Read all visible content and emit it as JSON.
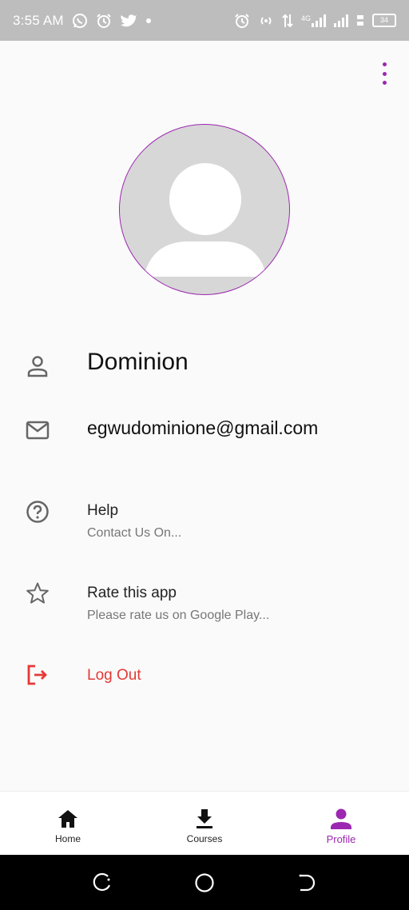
{
  "status_bar": {
    "time": "3:55 AM",
    "network": "4G",
    "battery": "34"
  },
  "profile": {
    "name": "Dominion",
    "email": "egwudominione@gmail.com"
  },
  "menu": {
    "help_title": "Help",
    "help_subtitle": "Contact Us On...",
    "rate_title": "Rate this app",
    "rate_subtitle": "Please rate us on Google Play...",
    "logout_label": "Log Out"
  },
  "bottom_nav": {
    "items": [
      {
        "label": "Home",
        "icon": "home-icon"
      },
      {
        "label": "Courses",
        "icon": "download-icon"
      },
      {
        "label": "Profile",
        "icon": "person-icon",
        "active": true
      }
    ]
  },
  "colors": {
    "accent": "#9c27b0",
    "logout": "#e53935",
    "status_bar": "#bdbdbd"
  }
}
